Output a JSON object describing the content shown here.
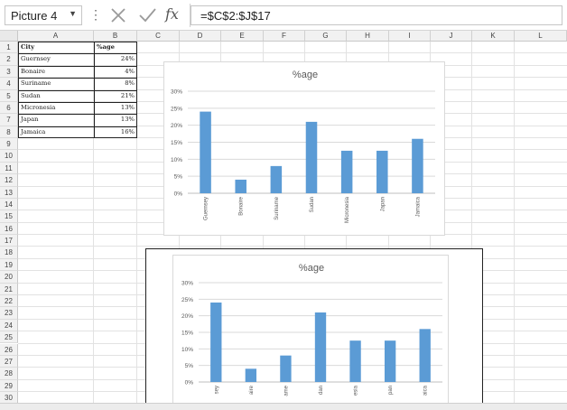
{
  "formula_bar": {
    "name_box": "Picture 4",
    "formula": "=$C$2:$J$17",
    "cancel_icon": "cancel-x-icon",
    "enter_icon": "enter-check-icon",
    "function_icon": "fx-icon",
    "function_label": "fx"
  },
  "columns": [
    "A",
    "B",
    "C",
    "D",
    "E",
    "F",
    "G",
    "H",
    "I",
    "J",
    "K",
    "L"
  ],
  "rows": [
    "1",
    "2",
    "3",
    "4",
    "5",
    "6",
    "7",
    "8",
    "9",
    "10",
    "11",
    "12",
    "13",
    "14",
    "15",
    "16",
    "17",
    "18",
    "19",
    "20",
    "21",
    "22",
    "23",
    "24",
    "25",
    "26",
    "27",
    "28",
    "29",
    "30"
  ],
  "table": {
    "header": [
      "City",
      "%age"
    ],
    "rows": [
      [
        "Guernsey",
        "24%"
      ],
      [
        "Bonaire",
        "4%"
      ],
      [
        "Suriname",
        "8%"
      ],
      [
        "Sudan",
        "21%"
      ],
      [
        "Micronesia",
        "13%"
      ],
      [
        "Japan",
        "13%"
      ],
      [
        "Jamaica",
        "16%"
      ]
    ]
  },
  "chart_data": [
    {
      "type": "bar",
      "title": "%age",
      "categories": [
        "Guernsey",
        "Bonaire",
        "Suriname",
        "Sudan",
        "Micronesia",
        "Japan",
        "Jamaica"
      ],
      "values": [
        24,
        4,
        8,
        21,
        12.5,
        12.5,
        16
      ],
      "yticks": [
        "0%",
        "5%",
        "10%",
        "15%",
        "20%",
        "25%",
        "30%"
      ],
      "ylim": [
        0,
        30
      ],
      "grid": true,
      "color": "#5b9bd5"
    },
    {
      "type": "bar",
      "title": "%age",
      "categories": [
        "sey",
        "aire",
        "ame",
        "dan",
        "esia",
        "pan",
        "aica"
      ],
      "values": [
        24,
        4,
        8,
        21,
        12.5,
        12.5,
        16
      ],
      "yticks": [
        "0%",
        "5%",
        "10%",
        "15%",
        "20%",
        "25%",
        "30%"
      ],
      "ylim": [
        0,
        30
      ],
      "grid": true,
      "color": "#5b9bd5"
    }
  ]
}
